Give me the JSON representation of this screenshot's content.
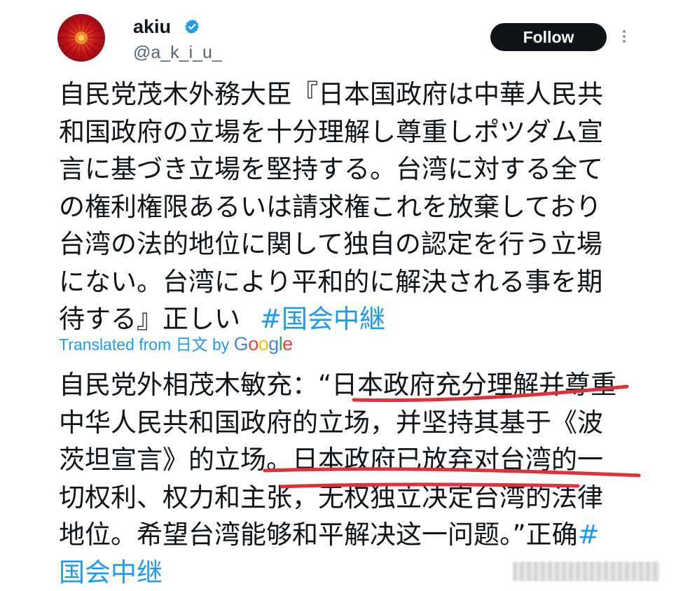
{
  "author": {
    "display_name": "akiu",
    "handle": "@a_k_i_u_",
    "verified": true,
    "avatar_icon": "red-dahlia-avatar"
  },
  "follow_button": {
    "label": "Follow"
  },
  "more_menu": {
    "icon": "more-vertical-icon"
  },
  "tweet": {
    "text": "自民党茂木外務大臣『日本国政府は中華人民共和国政府の立場を十分理解し尊重しポツダム宣言に基づき立場を堅持する。台湾に対する全ての権利権限あるいは請求権これを放棄しており台湾の法的地位に関して独自の認定を行う立場にない。台湾により平和的に解決される事を期待する』正しい",
    "hashtag": "#国会中継"
  },
  "translation_label": {
    "prefix": "Translated from 日文 by ",
    "brand": [
      "G",
      "o",
      "o",
      "g",
      "l",
      "e"
    ]
  },
  "translation": {
    "text": "自民党外相茂木敏充：“日本政府充分理解并尊重中华人民共和国政府的立场，并坚持其基于《波茨坦宣言》的立场。日本政府已放弃对台湾的一切权利、权力和主张，无权独立决定台湾的法律地位。希望台湾能够和平解决这一问题。”正确",
    "hashtag": "#国会中继"
  },
  "colors": {
    "link": "#1d9bf0",
    "text": "#0f1419",
    "secondary": "#536471",
    "underline": "#e0303a"
  }
}
